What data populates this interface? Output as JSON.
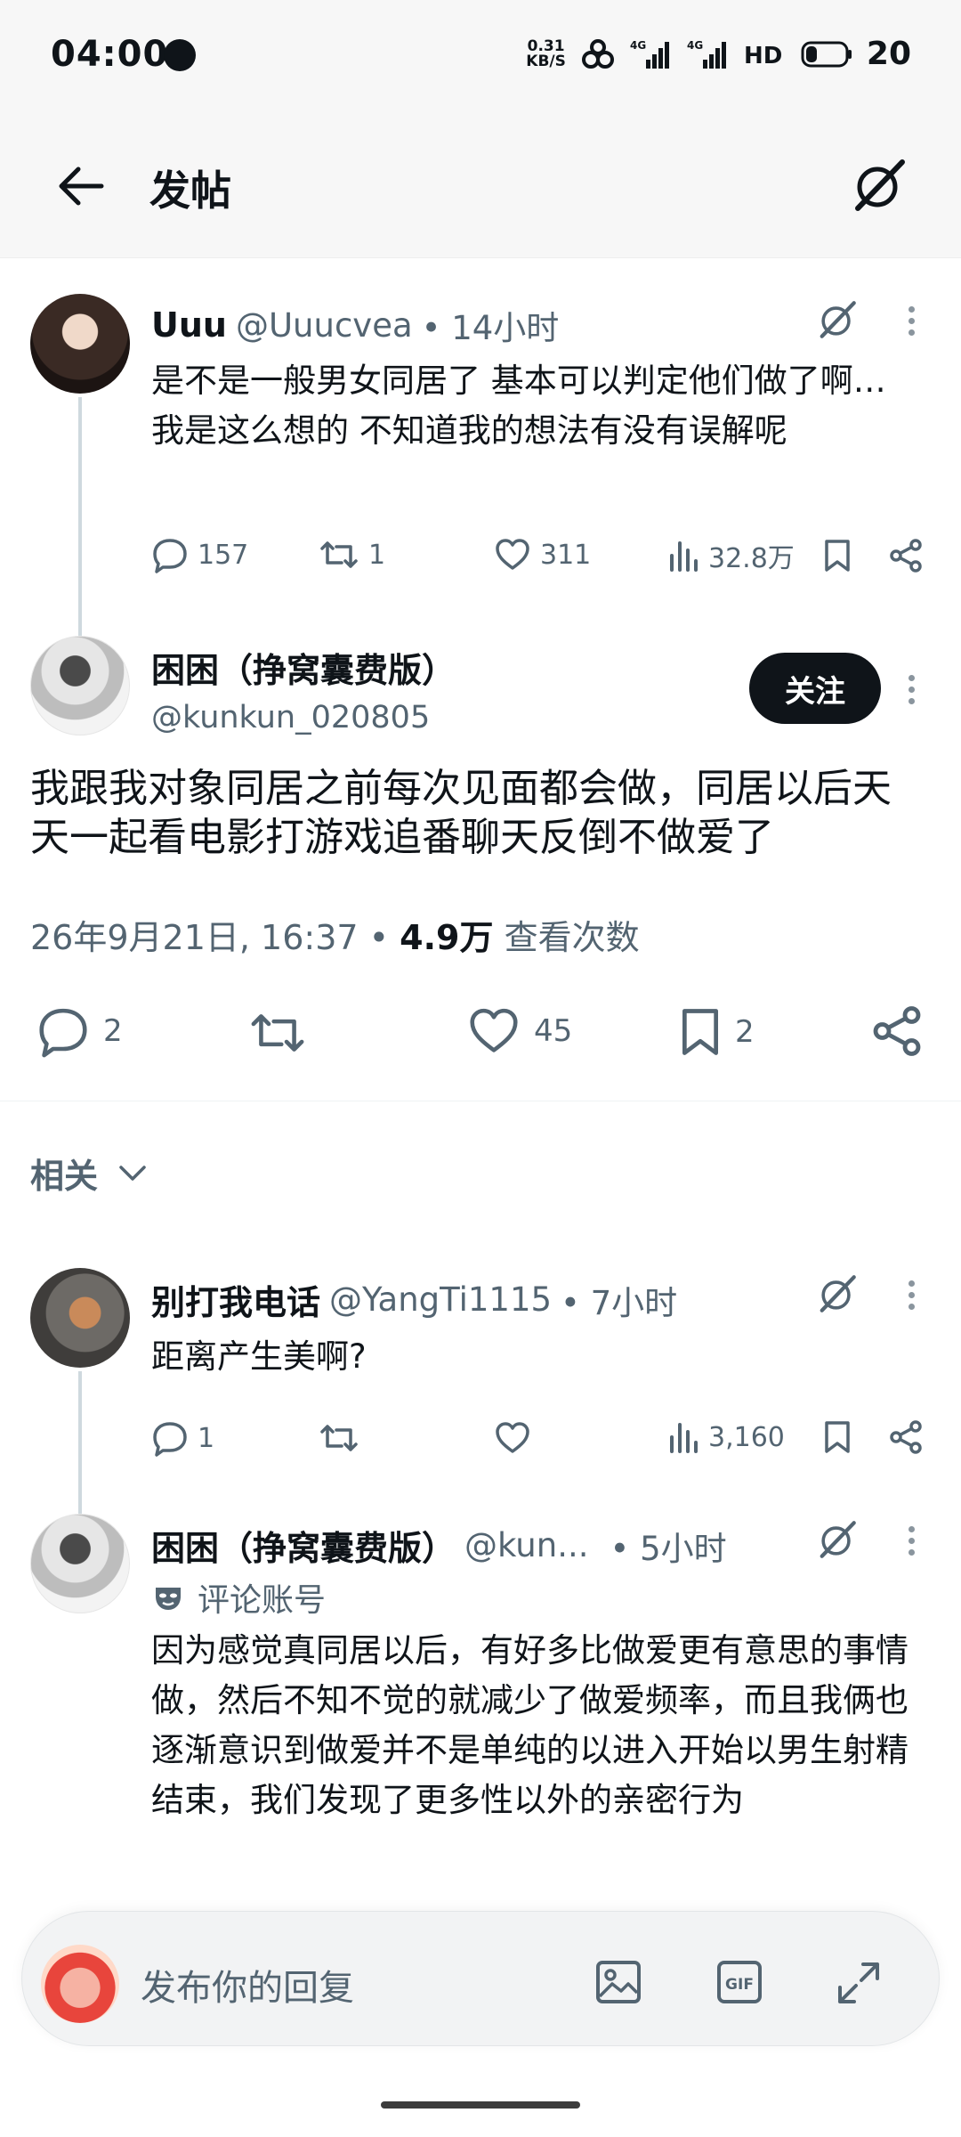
{
  "status": {
    "time": "04:00",
    "net_speed_top": "0.31",
    "net_speed_bottom": "KB/S",
    "battery": "20"
  },
  "header": {
    "title": "发帖"
  },
  "parent_tweet": {
    "name": "Uuu",
    "handle": "@Uuucvea",
    "time": "• 14小时",
    "text": "是不是一般男女同居了 基本可以判定他们做了啊… 我是这么想的 不知道我的想法有没有误解呢",
    "replies": "157",
    "retweets": "1",
    "likes": "311",
    "views": "32.8万"
  },
  "main_tweet": {
    "name": "困困（挣窝囊费版）",
    "handle": "@kunkun_020805",
    "follow_label": "关注",
    "text": "我跟我对象同居之前每次见面都会做，同居以后天天一起看电影打游戏追番聊天反倒不做爱了",
    "date": "26年9月21日, 16:37",
    "views_count": "4.9万",
    "views_label": "查看次数",
    "replies": "2",
    "likes": "45",
    "bookmarks": "2"
  },
  "related": {
    "label": "相关"
  },
  "reply1": {
    "name": "别打我电话",
    "handle": "@YangTi1115",
    "time": "• 7小时",
    "text": "距离产生美啊?",
    "replies": "1",
    "views": "3,160"
  },
  "reply2": {
    "name": "困困（挣窝囊费版）",
    "handle": "@kun...",
    "time": "• 5小时",
    "badge": "评论账号",
    "text": "因为感觉真同居以后，有好多比做爱更有意思的事情做，然后不知不觉的就减少了做爱频率，而且我俩也逐渐意识到做爱并不是单纯的以进入开始以男生射精结束，我们发现了更多性以外的亲密行为"
  },
  "reply_bar": {
    "placeholder": "发布你的回复"
  },
  "colors": {
    "text": "#0f1419",
    "secondary": "#536471",
    "divider": "#eff3f4"
  }
}
